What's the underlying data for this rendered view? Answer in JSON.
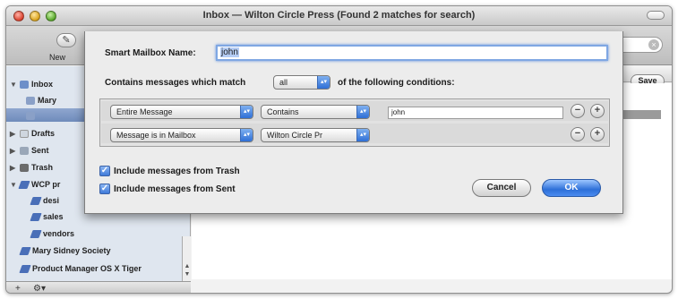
{
  "window": {
    "title": "Inbox — Wilton Circle Press (Found 2 matches for search)"
  },
  "toolbar": {
    "new_label": "New",
    "save_label": "Save"
  },
  "sidebar": {
    "items": [
      {
        "label": "Inbox",
        "icon": "inbox-icon"
      },
      {
        "label": "Mary",
        "icon": "mailbox-icon"
      },
      {
        "label": "",
        "icon": "mailbox-icon"
      },
      {
        "label": "Drafts",
        "icon": "drafts-icon"
      },
      {
        "label": "Sent",
        "icon": "sent-icon"
      },
      {
        "label": "Trash",
        "icon": "trash-icon"
      },
      {
        "label": "WCP pr",
        "icon": "smart-folder-icon"
      },
      {
        "label": "desi",
        "icon": "smart-mailbox-icon"
      },
      {
        "label": "sales",
        "icon": "smart-mailbox-icon"
      },
      {
        "label": "vendors",
        "icon": "smart-mailbox-icon"
      },
      {
        "label": "Mary Sidney Society",
        "icon": "smart-mailbox-icon"
      },
      {
        "label": "Product Manager OS X Tiger",
        "icon": "smart-mailbox-icon"
      }
    ],
    "bottom": {
      "add": "+",
      "action": "⚙▾"
    }
  },
  "sheet": {
    "name_label": "Smart Mailbox Name:",
    "name_value": "john",
    "match_prefix": "Contains messages which match",
    "match_value": "all",
    "match_suffix": "of the following conditions:",
    "conditions": [
      {
        "field": "Entire Message",
        "operator": "Contains",
        "value": "john"
      },
      {
        "field": "Message is in Mailbox",
        "operator": "Wilton Circle Pr",
        "value": ""
      }
    ],
    "include_trash": "Include messages from Trash",
    "include_sent": "Include messages from Sent",
    "cancel_label": "Cancel",
    "ok_label": "OK"
  },
  "colors": {
    "accent": "#3f7ad9",
    "sidebar_bg": "#dfe6ef",
    "selection": "#7f98c4"
  }
}
